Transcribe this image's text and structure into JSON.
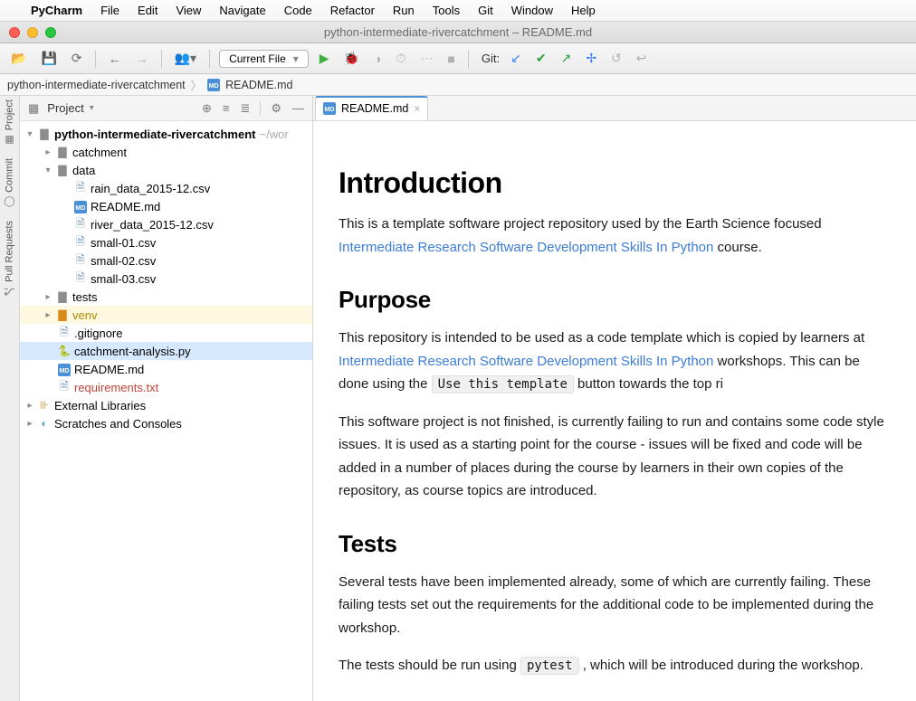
{
  "mac_menu": {
    "app": "PyCharm",
    "items": [
      "File",
      "Edit",
      "View",
      "Navigate",
      "Code",
      "Refactor",
      "Run",
      "Tools",
      "Git",
      "Window",
      "Help"
    ]
  },
  "window_title": "python-intermediate-rivercatchment – README.md",
  "toolbar": {
    "current_file": "Current File",
    "git_label": "Git:"
  },
  "breadcrumb": {
    "project": "python-intermediate-rivercatchment",
    "file": "README.md"
  },
  "left_strip": {
    "project": "Project",
    "commit": "Commit",
    "pull": "Pull Requests"
  },
  "project_panel": {
    "title": "Project",
    "root": "python-intermediate-rivercatchment",
    "root_path": "~/wor",
    "tree": {
      "catchment": "catchment",
      "data": "data",
      "data_children": [
        "rain_data_2015-12.csv",
        "README.md",
        "river_data_2015-12.csv",
        "small-01.csv",
        "small-02.csv",
        "small-03.csv"
      ],
      "tests": "tests",
      "venv": "venv",
      "gitignore": ".gitignore",
      "analysis": "catchment-analysis.py",
      "readme": "README.md",
      "requirements": "requirements.txt",
      "ext": "External Libraries",
      "scratch": "Scratches and Consoles"
    }
  },
  "editor": {
    "tab": "README.md",
    "h_intro": "Introduction",
    "p_intro_1a": "This is a template software project repository used by the Earth Science focused ",
    "p_intro_link": "Intermediate Research Software Development Skills In Python",
    "p_intro_1b": " course.",
    "h_purpose": "Purpose",
    "p_purpose_1a": "This repository is intended to be used as a code template which is copied by learners at ",
    "p_purpose_link": "Intermediate Research Software Development Skills In Python",
    "p_purpose_1b": " workshops. This can be done using the ",
    "code_template": "Use this template",
    "p_purpose_1c": " button towards the top ri",
    "p_purpose_2": "This software project is not finished, is currently failing to run and contains some code style issues. It is used as a starting point for the course - issues will be fixed and code will be added in a number of places during the course by learners in their own copies of the repository, as course topics are introduced.",
    "h_tests": "Tests",
    "p_tests_1": "Several tests have been implemented already, some of which are currently failing. These failing tests set out the requirements for the additional code to be implemented during the workshop.",
    "p_tests_2a": "The tests should be run using ",
    "code_pytest": "pytest",
    "p_tests_2b": " , which will be introduced during the workshop."
  }
}
